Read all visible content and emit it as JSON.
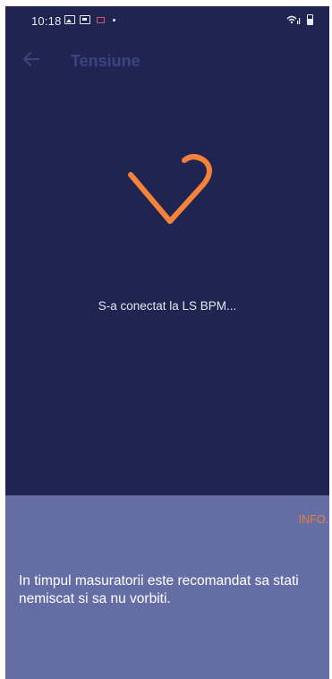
{
  "status_bar": {
    "time": "10:18",
    "icons": [
      "gallery-icon",
      "gallery-icon",
      "mail-icon",
      "dot-icon",
      "wifi-icon",
      "signal-icon",
      "battery-icon"
    ]
  },
  "app_bar": {
    "title": "Tensiune",
    "back_icon": "arrow-left-icon"
  },
  "main": {
    "status_message": "S-a conectat la LS BPM...",
    "heart_icon": "heart-icon",
    "accent_color": "#f4823a"
  },
  "info_panel": {
    "link_label": "INFO.",
    "message": "In timpul masuratorii este recomandat sa stati nemiscat si sa nu vorbiti."
  },
  "colors": {
    "background": "#1f2550",
    "panel": "#656ea4",
    "accent": "#f07a3c",
    "title": "#3a4580"
  }
}
